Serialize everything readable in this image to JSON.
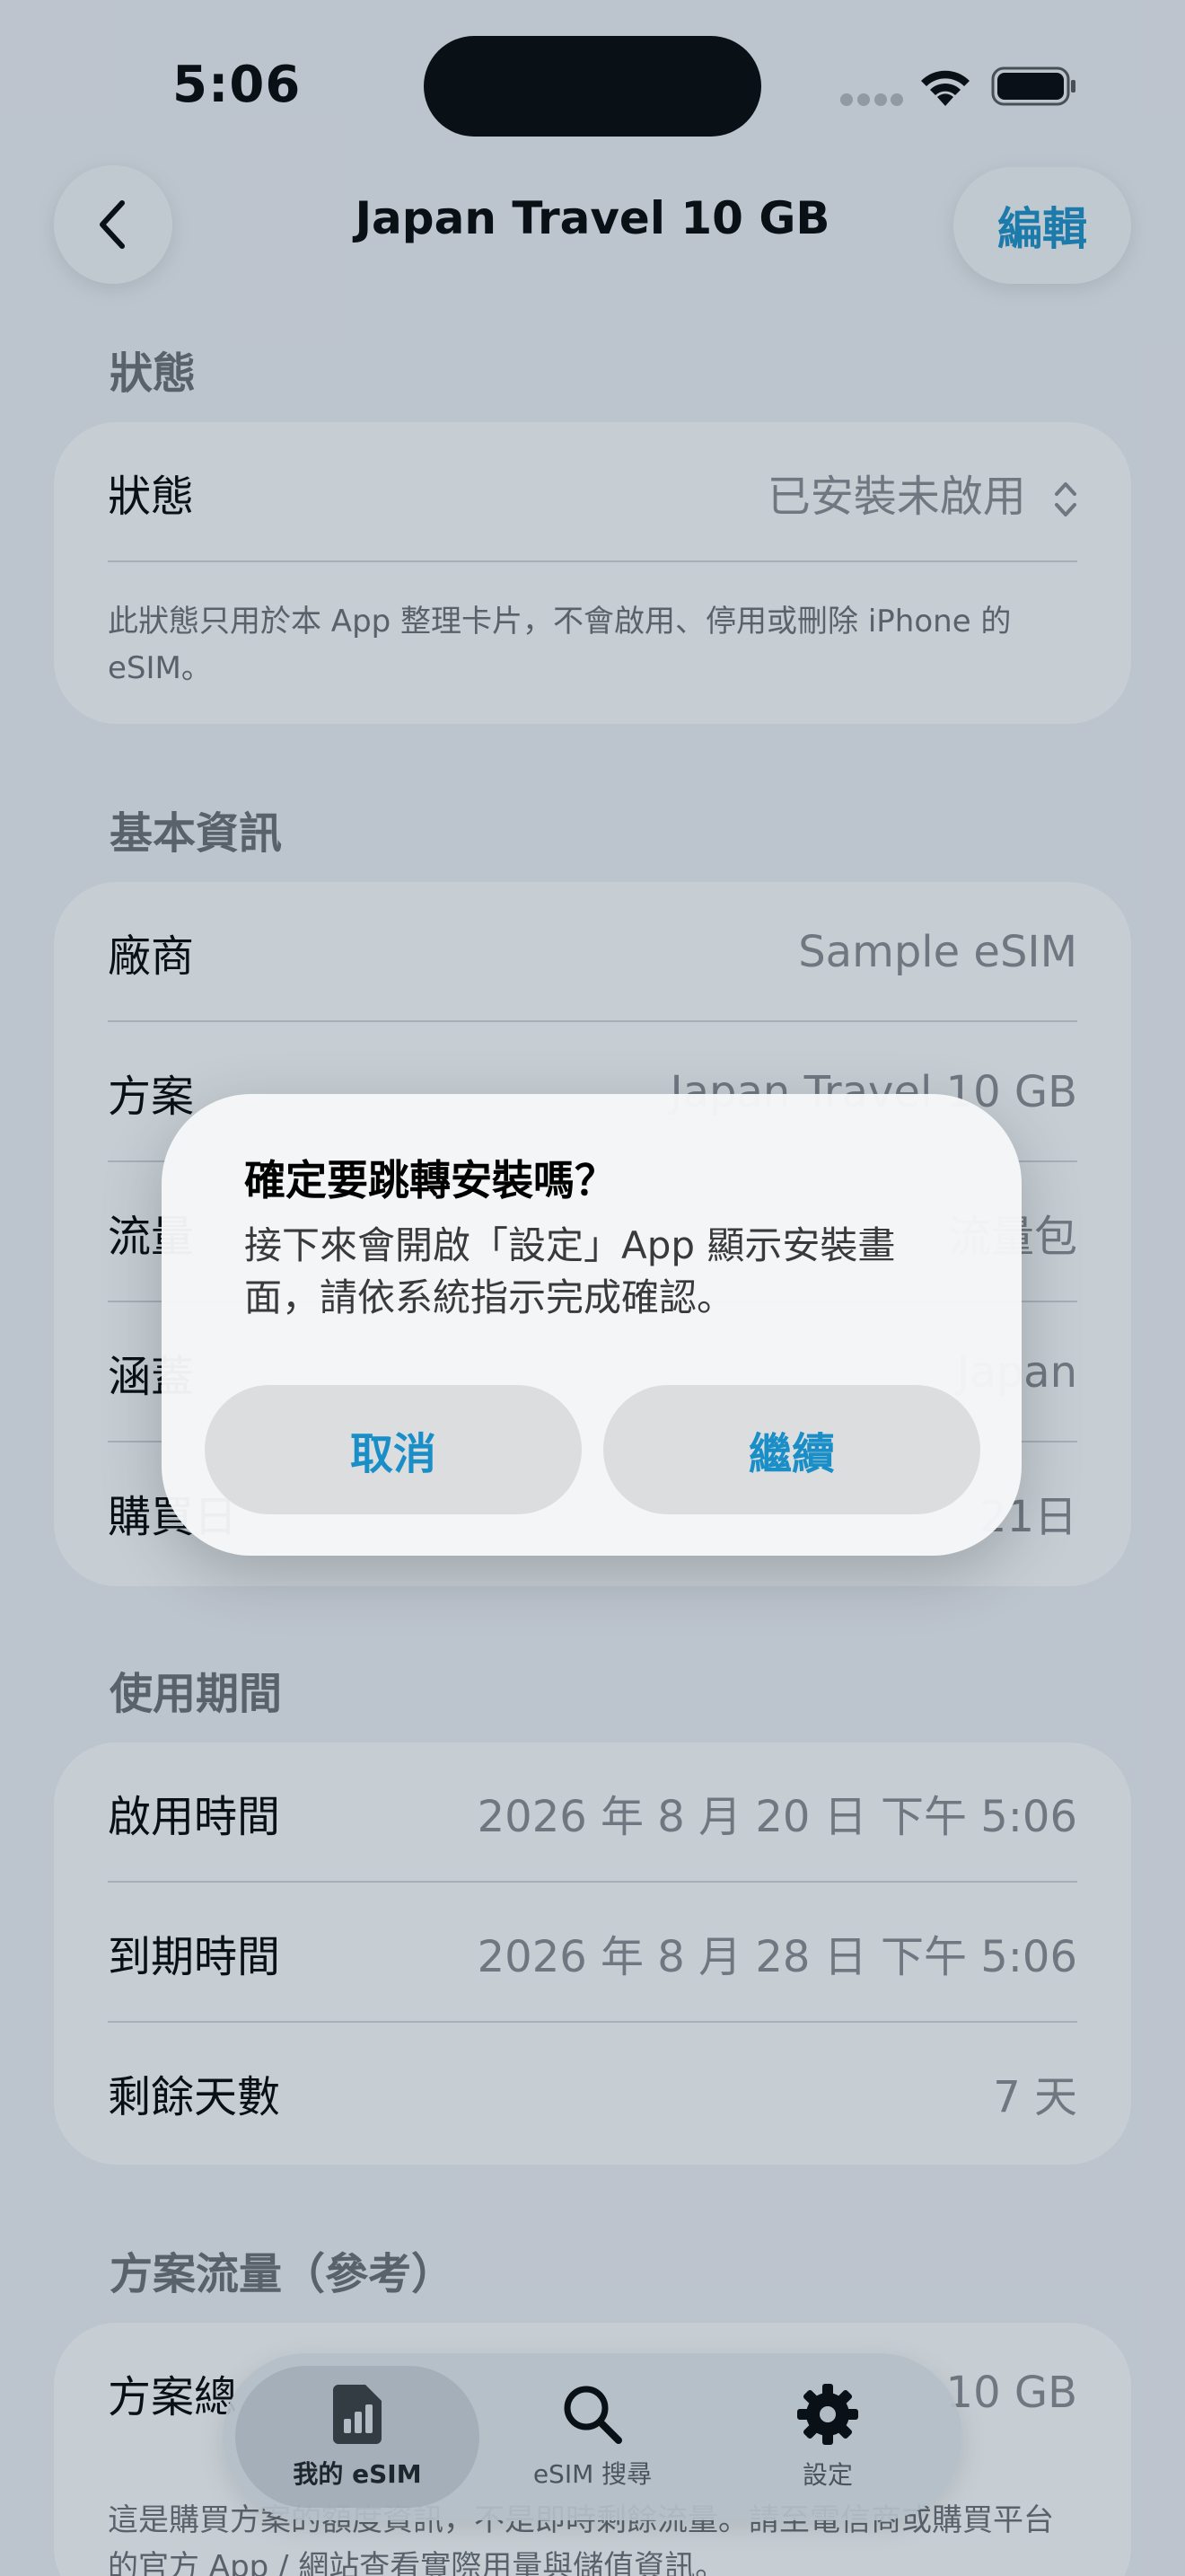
{
  "status_bar": {
    "time": "5:06"
  },
  "nav": {
    "title": "Japan Travel 10 GB",
    "edit_label": "編輯",
    "back_icon": "chevron-left-icon"
  },
  "sections": {
    "status": {
      "header": "狀態",
      "row_label": "狀態",
      "row_value": "已安裝未啟用",
      "note": "此狀態只用於本 App 整理卡片，不會啟用、停用或刪除 iPhone 的 eSIM。"
    },
    "basic": {
      "header": "基本資訊",
      "rows": [
        {
          "label": "廠商",
          "value": "Sample eSIM"
        },
        {
          "label": "方案",
          "value": "Japan Travel 10 GB"
        },
        {
          "label": "流量",
          "value": "流量包"
        },
        {
          "label": "涵蓋",
          "value": "Japan"
        },
        {
          "label": "購買日",
          "value": "21日"
        }
      ]
    },
    "period": {
      "header": "使用期間",
      "rows": [
        {
          "label": "啟用時間",
          "value": "2026 年 8 月 20 日 下午 5:06"
        },
        {
          "label": "到期時間",
          "value": "2026 年 8 月 28 日 下午 5:06"
        },
        {
          "label": "剩餘天數",
          "value": "7 天"
        }
      ]
    },
    "data": {
      "header": "方案流量（參考）",
      "row_label": "方案總",
      "row_value": "10 GB",
      "note": "這是購買方案的額度資訊，不是即時剩餘流量。請至電信商或購買平台的官方 App / 網站查看實際用量與儲值資訊。"
    }
  },
  "alert": {
    "title": "確定要跳轉安裝嗎？",
    "message": "接下來會開啟「設定」App 顯示安裝畫面，請依系統指示完成確認。",
    "cancel_label": "取消",
    "continue_label": "繼續"
  },
  "tab_bar": {
    "tabs": [
      {
        "label": "我的 eSIM",
        "icon": "sim-card-icon",
        "selected": true
      },
      {
        "label": "eSIM 搜尋",
        "icon": "search-icon",
        "selected": false
      },
      {
        "label": "設定",
        "icon": "gear-icon",
        "selected": false
      }
    ]
  },
  "colors": {
    "accent": "#1a8fc7",
    "background": "#f2f2f7",
    "card": "#ffffff",
    "dim_overlay": "rgba(36,66,88,0.26)"
  }
}
